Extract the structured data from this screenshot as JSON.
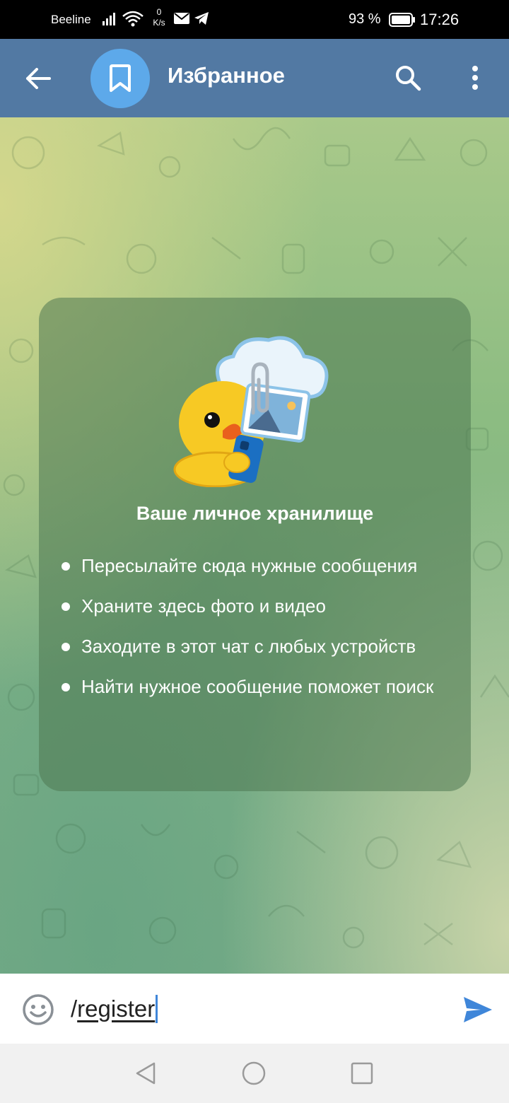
{
  "status_bar": {
    "carrier": "Beeline",
    "speed_value": "0",
    "speed_unit": "K/s",
    "battery_percent": "93 %",
    "time": "17:26",
    "icons": [
      "signal-icon",
      "wifi-icon",
      "mail-icon",
      "telegram-icon",
      "battery-icon"
    ]
  },
  "header": {
    "title": "Избранное",
    "icons": [
      "back-arrow-icon",
      "bookmark-icon",
      "search-icon",
      "more-vertical-icon"
    ]
  },
  "card": {
    "title": "Ваше личное хранилище",
    "items": [
      "Пересылайте сюда нужные сообщения",
      "Храните здесь фото и видео",
      "Заходите в этот чат с любых устройств",
      "Найти нужное сообщение поможет поиск"
    ]
  },
  "input": {
    "slash": "/",
    "command": "register",
    "icons": [
      "emoji-icon",
      "send-icon"
    ]
  },
  "colors": {
    "header": "#5279a3",
    "avatar": "#5da9ea",
    "send": "#3f86d9",
    "nav_bar": "#f1f1f1"
  }
}
